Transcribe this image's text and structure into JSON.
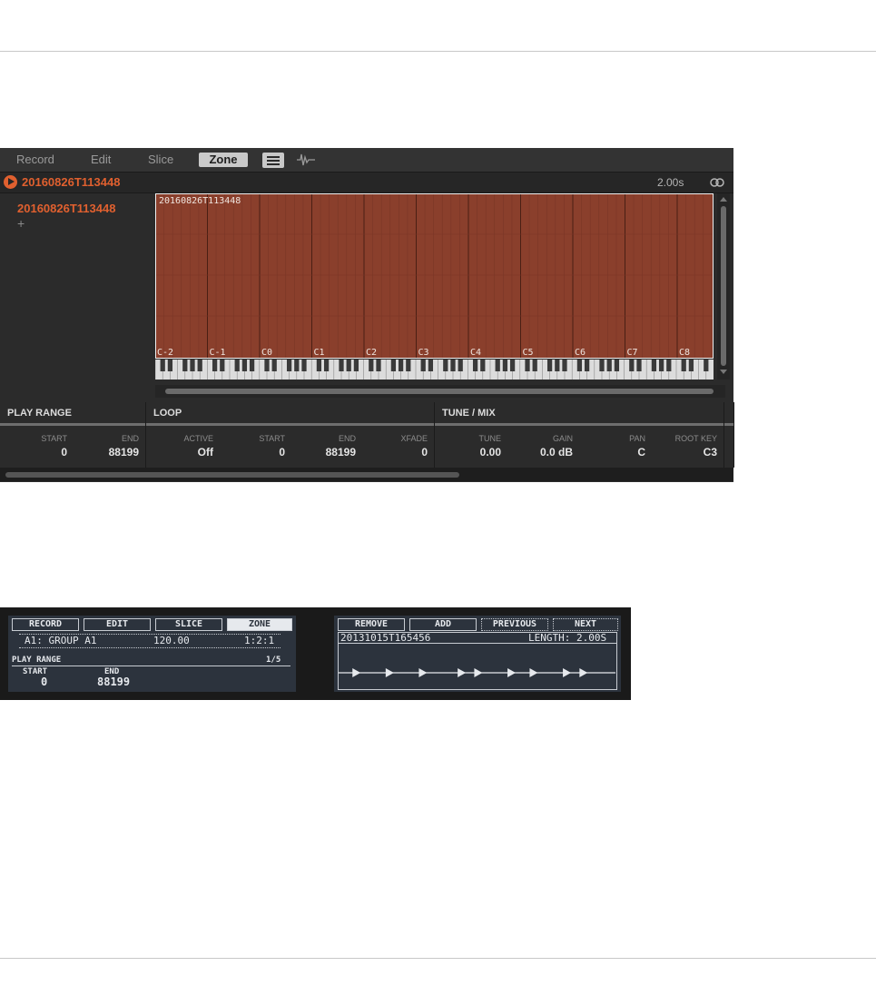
{
  "sampler": {
    "tabs": [
      "Record",
      "Edit",
      "Slice",
      "Zone"
    ],
    "active_tab": "Zone",
    "header": {
      "sample_name": "20160826T113448",
      "duration": "2.00s"
    },
    "sample_list": {
      "items": [
        "20160826T113448"
      ],
      "add_label": "+"
    },
    "zone": {
      "label": "20160826T113448",
      "fill_color": "#8a3f2c",
      "key_labels": [
        "C-2",
        "C-1",
        "C0",
        "C1",
        "C2",
        "C3",
        "C4",
        "C5",
        "C6",
        "C7",
        "C8"
      ]
    },
    "params": {
      "play_range": {
        "title": "PLAY RANGE",
        "start_label": "START",
        "start_value": "0",
        "end_label": "END",
        "end_value": "88199"
      },
      "loop": {
        "title": "LOOP",
        "active_label": "ACTIVE",
        "active_value": "Off",
        "start_label": "START",
        "start_value": "0",
        "end_label": "END",
        "end_value": "88199",
        "xfade_label": "XFADE",
        "xfade_value": "0"
      },
      "tune_mix": {
        "title": "TUNE / MIX",
        "tune_label": "TUNE",
        "tune_value": "0.00",
        "gain_label": "GAIN",
        "gain_value": "0.0 dB",
        "pan_label": "PAN",
        "pan_value": "C",
        "rootkey_label": "ROOT KEY",
        "rootkey_value": "C3"
      }
    },
    "accent_color": "#e0602f"
  },
  "hardware": {
    "left": {
      "tabs": [
        "RECORD",
        "EDIT",
        "SLICE",
        "ZONE"
      ],
      "active_tab": "ZONE",
      "group": "A1: GROUP A1",
      "tempo": "120.00",
      "position": "1:2:1",
      "section": "PLAY RANGE",
      "page": "1/5",
      "start_label": "START",
      "start_value": "0",
      "end_label": "END",
      "end_value": "88199"
    },
    "right": {
      "buttons": [
        "REMOVE",
        "ADD",
        "PREVIOUS",
        "NEXT"
      ],
      "sample_name": "20131015T165456",
      "length": "LENGTH: 2.00S",
      "markers": [
        0.05,
        0.17,
        0.29,
        0.43,
        0.49,
        0.61,
        0.69,
        0.81,
        0.87
      ]
    }
  }
}
